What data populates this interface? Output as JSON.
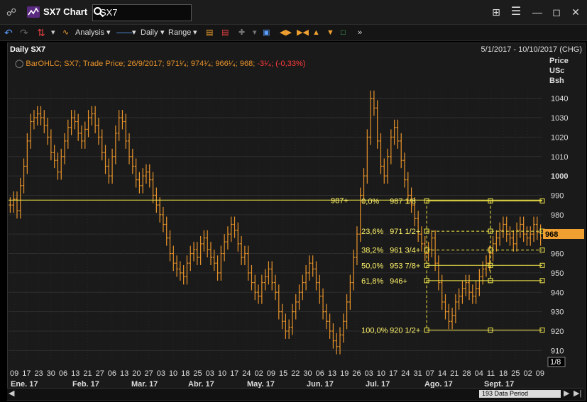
{
  "window": {
    "title": "SX7 Chart",
    "search_value": "SX7"
  },
  "toolbar": {
    "analysis": "Analysis",
    "period": "Daily",
    "range": "Range"
  },
  "header": {
    "chart_name": "Daily SX7",
    "date_range": "5/1/2017 - 10/10/2017 (CHG)"
  },
  "legend": {
    "text": "BarOHLC; SX7; Trade Price; 26/9/2017; 971¹⁄₄; 974¹⁄₄; 966¹⁄₄; 968;",
    "change": "-3¹⁄₄; (-0,33%)"
  },
  "axis": {
    "title_lines": [
      "Price",
      "USc",
      "Bsh"
    ],
    "last_price": "968",
    "page_indicator": "1/8",
    "data_period": "193 Data Period"
  },
  "colors": {
    "bars": "#e8932a",
    "fib": "#f5e94a",
    "price_box": "#f0a030"
  },
  "chart_data": {
    "type": "ohlc",
    "title": "Daily SX7",
    "ylim": [
      905,
      1045
    ],
    "y_ticks": [
      910,
      920,
      930,
      940,
      950,
      960,
      970,
      980,
      990,
      1000,
      1010,
      1020,
      1030,
      1040
    ],
    "y_tick_labels": [
      "910",
      "920",
      "930",
      "940",
      "950",
      "960",
      "970",
      "980",
      "990",
      "1000",
      "1010",
      "1020",
      "1030",
      "1040"
    ],
    "x_day_labels": [
      "09",
      "17",
      "23",
      "30",
      "06",
      "13",
      "21",
      "27",
      "06",
      "13",
      "20",
      "27",
      "03",
      "10",
      "18",
      "25",
      "03",
      "10",
      "17",
      "24",
      "02",
      "09",
      "15",
      "22",
      "30",
      "06",
      "13",
      "19",
      "26",
      "03",
      "10",
      "17",
      "24",
      "31",
      "07",
      "14",
      "21",
      "28",
      "04",
      "11",
      "18",
      "25",
      "02",
      "09"
    ],
    "x_month_labels": [
      "Ene. 17",
      "Feb. 17",
      "Mar. 17",
      "Abr. 17",
      "May. 17",
      "Jun. 17",
      "Jul. 17",
      "Ago. 17",
      "Sept. 17"
    ],
    "last_close": 968,
    "horizontal_line": {
      "label": "987+",
      "value": 987.5
    },
    "fibonacci": [
      {
        "pct": "0,0%",
        "value_label": "987 1/8",
        "value": 987.125
      },
      {
        "pct": "23,6%",
        "value_label": "971 1/2+",
        "value": 971.5
      },
      {
        "pct": "38,2%",
        "value_label": "961 3/4+",
        "value": 961.75
      },
      {
        "pct": "50,0%",
        "value_label": "953 7/8+",
        "value": 953.875
      },
      {
        "pct": "61,8%",
        "value_label": "946+",
        "value": 946.0
      },
      {
        "pct": "100,0%",
        "value_label": "920 1/2+",
        "value": 920.5
      }
    ],
    "series_close": [
      985,
      988,
      982,
      995,
      1005,
      1018,
      1028,
      1030,
      1032,
      1030,
      1026,
      1020,
      1012,
      1008,
      1002,
      1010,
      1018,
      1025,
      1030,
      1028,
      1022,
      1018,
      1024,
      1030,
      1032,
      1026,
      1020,
      1012,
      1005,
      1000,
      1010,
      1022,
      1030,
      1028,
      1018,
      1010,
      1005,
      998,
      995,
      1000,
      1002,
      998,
      990,
      985,
      980,
      975,
      968,
      960,
      955,
      952,
      950,
      948,
      955,
      960,
      962,
      958,
      965,
      968,
      962,
      958,
      955,
      950,
      960,
      966,
      970,
      975,
      972,
      965,
      958,
      960,
      950,
      945,
      940,
      938,
      945,
      948,
      952,
      945,
      940,
      930,
      925,
      920,
      922,
      930,
      935,
      940,
      945,
      950,
      955,
      952,
      945,
      938,
      930,
      925,
      920,
      915,
      912,
      918,
      925,
      935,
      945,
      958,
      970,
      990,
      1000,
      1020,
      1040,
      1035,
      1018,
      1005,
      1000,
      1010,
      1020,
      1025,
      1018,
      1008,
      998,
      990,
      985,
      978,
      970,
      965,
      960,
      962,
      968,
      955,
      945,
      935,
      930,
      925,
      928,
      935,
      938,
      942,
      945,
      940,
      938,
      942,
      948,
      952,
      955,
      960,
      965,
      968,
      972,
      975,
      970,
      968,
      965,
      972,
      975,
      970,
      968,
      970,
      975,
      971,
      968
    ],
    "fib_anchor_index": 123
  }
}
